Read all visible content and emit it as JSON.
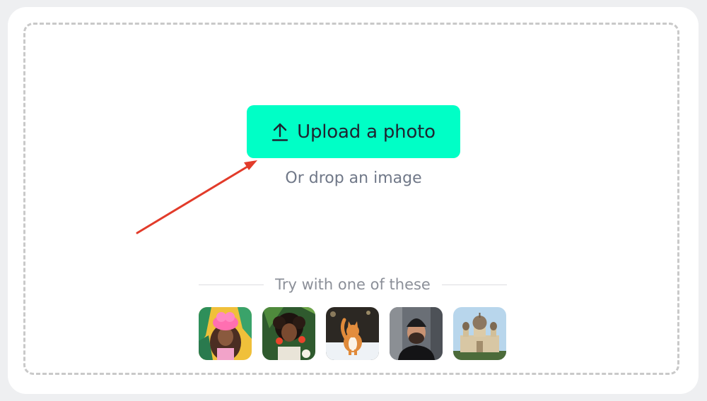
{
  "upload": {
    "button_label": "Upload a photo",
    "icon": "upload-arrow-icon",
    "accent_color": "#00ffc6",
    "drop_text": "Or drop an image"
  },
  "annotation": {
    "icon": "red-arrow-pointer",
    "color": "#e23b2a"
  },
  "samples": {
    "heading": "Try with one of these",
    "items": [
      {
        "name": "woman-pink-headwrap",
        "icon": "portrait-thumbnail"
      },
      {
        "name": "woman-curly-hair-tropical",
        "icon": "portrait-thumbnail"
      },
      {
        "name": "cat-in-snow",
        "icon": "pet-thumbnail"
      },
      {
        "name": "man-beanie-street",
        "icon": "portrait-thumbnail"
      },
      {
        "name": "domed-church",
        "icon": "building-thumbnail"
      }
    ]
  }
}
